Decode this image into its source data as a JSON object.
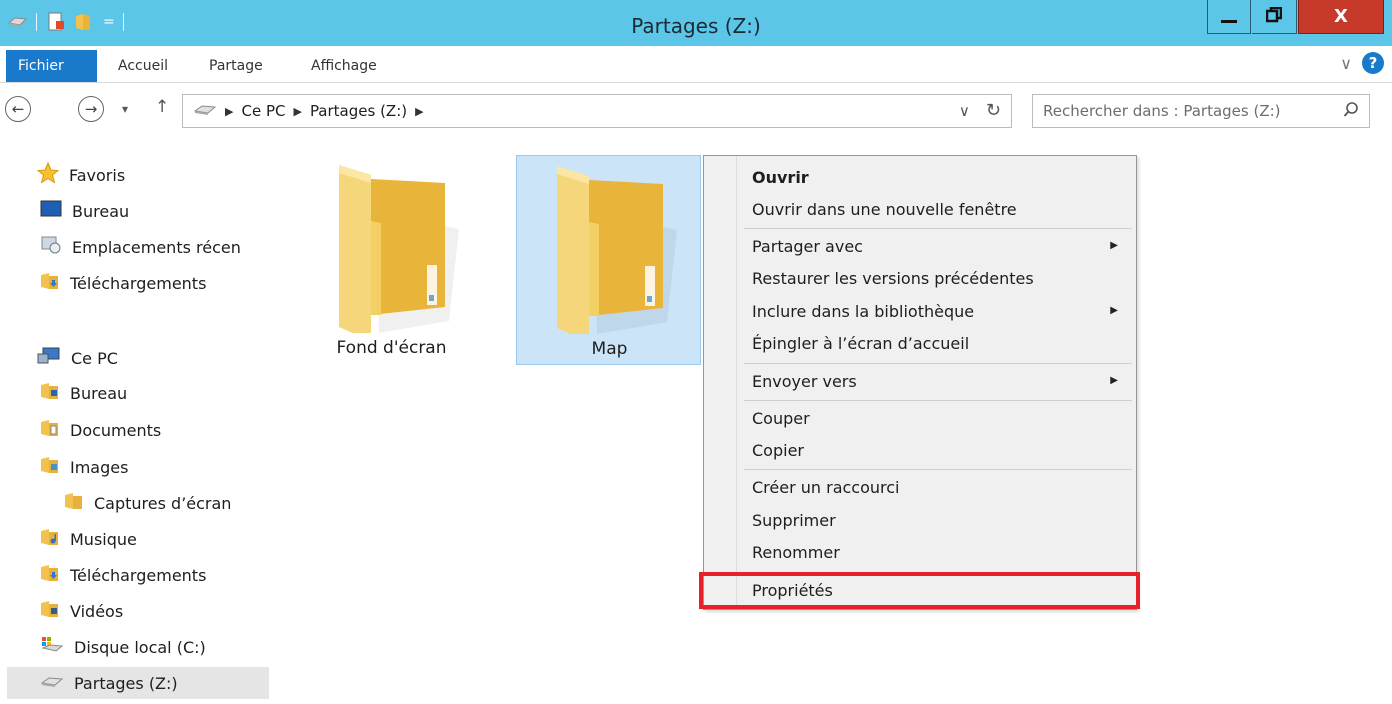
{
  "window": {
    "title": "Partages (Z:)",
    "minimize_glyph": "—",
    "maximize_glyph": "❐",
    "close_glyph": "X",
    "qat_dropdown": "="
  },
  "ribbon": {
    "file_tab": "Fichier",
    "tabs": [
      "Accueil",
      "Partage",
      "Affichage"
    ],
    "expand_glyph": "∨",
    "help_glyph": "?"
  },
  "nav": {
    "back_glyph": "←",
    "forward_glyph": "→",
    "recent_glyph": "▾",
    "up_glyph": "↑",
    "breadcrumb": [
      "Ce PC",
      "Partages (Z:)"
    ],
    "crumb_sep": "▶",
    "dropdown_glyph": "∨",
    "refresh_glyph": "↻",
    "search_placeholder": "Rechercher dans : Partages (Z:)"
  },
  "sidebar": {
    "favorites_label": "Favoris",
    "favorites": [
      "Bureau",
      "Emplacements récen",
      "Téléchargements"
    ],
    "pc_label": "Ce PC",
    "pc_items": [
      "Bureau",
      "Documents",
      "Images",
      "Captures d’écran",
      "Musique",
      "Téléchargements",
      "Vidéos",
      "Disque local (C:)",
      "Partages (Z:)"
    ]
  },
  "content": {
    "folders": [
      "Fond d'écran",
      "Map"
    ]
  },
  "context_menu": {
    "items": [
      "Ouvrir",
      "Ouvrir dans une nouvelle fenêtre",
      "Partager avec",
      "Restaurer les versions précédentes",
      "Inclure dans la bibliothèque",
      "Épingler à l’écran d’accueil",
      "Envoyer vers",
      "Couper",
      "Copier",
      "Créer un raccourci",
      "Supprimer",
      "Renommer",
      "Propriétés"
    ],
    "submenu_glyph": "▶"
  },
  "colors": {
    "titlebar": "#5bc6e8",
    "file_tab": "#1979ca",
    "close_button": "#c73a2b",
    "selection": "#cce4f8",
    "highlight": "#e8202a"
  }
}
